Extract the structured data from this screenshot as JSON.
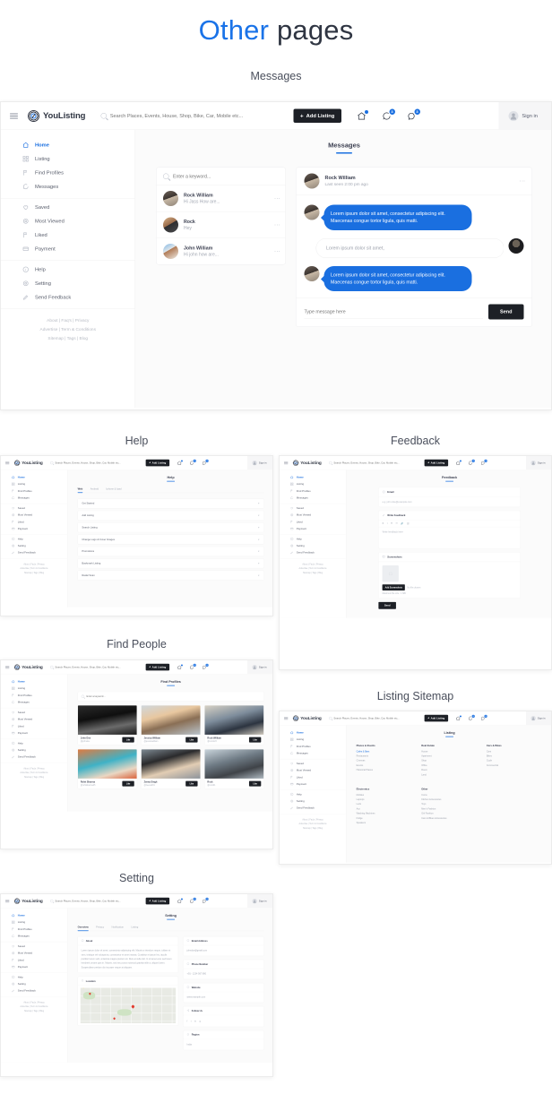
{
  "header": {
    "title_accent": "Other",
    "title_rest": " pages"
  },
  "app": {
    "logo_text": "YouListing",
    "search_placeholder": "Search Places, Events, House, Shop, Bike, Car, Mobile etc...",
    "add_listing_label": "Add Listing",
    "sign_in_label": "Sign in",
    "badges": {
      "home": "",
      "messages": "3",
      "notifications": "3"
    },
    "sidebar": {
      "group1": [
        {
          "label": "Home",
          "icon": "home-icon",
          "active": true
        },
        {
          "label": "Listing",
          "icon": "grid-icon"
        },
        {
          "label": "Find Profiles",
          "icon": "flag-icon"
        },
        {
          "label": "Messages",
          "icon": "chat-icon"
        }
      ],
      "group2": [
        {
          "label": "Saved",
          "icon": "heart-icon"
        },
        {
          "label": "Most Viewed",
          "icon": "eye-icon"
        },
        {
          "label": "Liked",
          "icon": "flag-icon"
        },
        {
          "label": "Payment",
          "icon": "card-icon"
        }
      ],
      "group3": [
        {
          "label": "Help",
          "icon": "info-icon"
        },
        {
          "label": "Setting",
          "icon": "gear-icon"
        },
        {
          "label": "Send Feedback",
          "icon": "pencil-icon"
        }
      ],
      "footer": [
        "About  |  Faq's  |  Privacy",
        "Advertise  |  Term & Conditions",
        "Sitemap  |  Tags  |  Blog"
      ]
    }
  },
  "sections": {
    "messages": {
      "caption": "Messages",
      "page_title": "Messages",
      "search_placeholder": "Enter a keyword...",
      "conversations": [
        {
          "name": "Rock William",
          "preview": "Hi Jass How are..."
        },
        {
          "name": "Rock",
          "preview": "Hey"
        },
        {
          "name": "John William",
          "preview": "Hi john how are..."
        }
      ],
      "chat": {
        "name": "Rock William",
        "status": "Last seen 2:00 pm ago",
        "messages": [
          {
            "from": "them",
            "text": "Lorem ipsum dolor sit amet, consectetur adipiscing elit. Maecenas congue tortor ligula, quis matti."
          },
          {
            "from": "me",
            "text": "Lorem ipsum dolor sit amet,"
          },
          {
            "from": "them",
            "text": "Lorem ipsum dolor sit amet, consectetur adipiscing elit. Maecenas congue tortor ligula, quis matti."
          }
        ],
        "input_placeholder": "Type message here",
        "send_label": "Send"
      }
    },
    "help": {
      "caption": "Help",
      "page_title": "Help",
      "tabs": [
        "Web",
        "Android",
        "Iphone & Ipad"
      ],
      "items": [
        "Get Started",
        "Add Listing",
        "Search Listing",
        "Change Logo & Cover Images",
        "Promotions",
        "Bookmark Listing",
        "Radar Scan"
      ]
    },
    "feedback": {
      "caption": "Feedback",
      "page_title": "Feedback",
      "email_label": "Email",
      "email_placeholder": "e.g. john.doe@example.com",
      "write_label": "Write Feedback",
      "write_placeholder": "Write feedback here",
      "screenshots_label": "Screenshots",
      "add_screenshot_label": "Add Screenshots",
      "no_file_text": "No file chosen",
      "max_size_text": "Maximum file size : 1 MB",
      "send_label": "Send"
    },
    "find_people": {
      "caption": "Find People",
      "page_title": "Find Profiles",
      "search_placeholder": "Enter a keyword...",
      "profiles": [
        {
          "name": "John Doe",
          "handle": "@johndoe"
        },
        {
          "name": "Jessica William",
          "handle": "@jessicawilliam"
        },
        {
          "name": "Rock William",
          "handle": "@rock123"
        },
        {
          "name": "Rohit Sharma",
          "handle": "@rohitsharma45"
        },
        {
          "name": "Zeena Singh",
          "handle": "@zeena001"
        },
        {
          "name": "Rock",
          "handle": "@rock01"
        }
      ],
      "like_label": "Like"
    },
    "sitemap": {
      "caption": "Listing Sitemap",
      "page_title": "Listing",
      "columns": [
        {
          "title": "Places & Events",
          "links": [
            "Cafes & Bars",
            "Restaurants",
            "Cinemas",
            "Events",
            "Historical Places"
          ],
          "highlight": 0
        },
        {
          "title": "Real Estate",
          "links": [
            "House",
            "Apartment",
            "Shop",
            "Office",
            "Room",
            "Land"
          ]
        },
        {
          "title": "Cars & Bikes",
          "links": [
            "Cars",
            "Bikes",
            "Cycle",
            "Commercial"
          ]
        },
        {
          "title": "Electronics",
          "links": [
            "Mobiles",
            "Laptops",
            "Leds",
            "Acs",
            "Washing Machines",
            "Fridge",
            "Speakers"
          ]
        },
        {
          "title": "Other",
          "links": [
            "Coins",
            "Kitchen Accessories",
            "Toys",
            "Men's Fashion",
            "Girl Fashion",
            "Cars & Bikes Accessories"
          ]
        }
      ]
    },
    "setting": {
      "caption": "Setting",
      "page_title": "Setting",
      "tabs": [
        "Overview",
        "Privacy",
        "Notification",
        "Listing"
      ],
      "about_label": "About",
      "about_text": "Lorem ipsum dolor sit amet, consectetur adipiscing elit. Mauris a interdum neque, tullam mi sem, tristique vel volutpat at, consectetur et amet massa. Curabitur et ipsum leo, iaculis porttitor lorem velit, at lacinia magna pretium sit. Duis at nulla nisl. In sit amet eros sed lorem hendrerit ornare quis in. Mauris, sed nec purus euismod gravida nibh a, aliquet lorem. Suspendisse pretium dio incorper neque at aliquam.",
      "location_label": "Location",
      "fields": [
        {
          "label": "Email Address",
          "value": "johndoe@gmail.com",
          "icon": "mail-icon"
        },
        {
          "label": "Phone Number",
          "value": "+91 - 1234 567 890",
          "icon": "phone-icon"
        },
        {
          "label": "Website",
          "value": "www.example.com",
          "icon": "globe-icon"
        },
        {
          "label": "Follow Us",
          "value": "",
          "icon": "share-icon"
        },
        {
          "label": "Region",
          "value": "India",
          "icon": "pin-icon"
        }
      ],
      "socials": [
        "f",
        "t",
        "in",
        "g"
      ]
    }
  },
  "colors": {
    "accent": "#1a6fe0",
    "dark": "#1d2026",
    "muted": "#a8adb8"
  }
}
